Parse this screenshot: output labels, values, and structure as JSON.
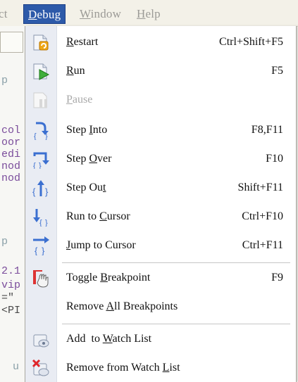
{
  "menubar": {
    "items": [
      {
        "pre": "ct",
        "acc": "",
        "post": ""
      },
      {
        "pre": "",
        "acc": "D",
        "post": "ebug"
      },
      {
        "pre": "",
        "acc": "W",
        "post": "indow"
      },
      {
        "pre": "",
        "acc": "H",
        "post": "elp"
      }
    ]
  },
  "editor": {
    "lines": [
      "p",
      "col",
      "oor",
      "edi",
      "nod",
      "nod",
      "p",
      "2.1",
      "vip",
      "=\"",
      "<PI",
      "u"
    ]
  },
  "menu": {
    "items": [
      {
        "pre": "",
        "acc": "R",
        "post": "estart",
        "shortcut": "Ctrl+Shift+F5",
        "icon": "restart-icon",
        "enabled": true
      },
      {
        "pre": "",
        "acc": "R",
        "post": "un",
        "shortcut": "F5",
        "icon": "run-icon",
        "enabled": true
      },
      {
        "pre": "",
        "acc": "P",
        "post": "ause",
        "shortcut": "",
        "icon": "pause-icon",
        "enabled": false
      },
      {
        "pre": "Step ",
        "acc": "I",
        "post": "nto",
        "shortcut": "F8,F11",
        "icon": "step-into-icon",
        "enabled": true
      },
      {
        "pre": "Step ",
        "acc": "O",
        "post": "ver",
        "shortcut": "F10",
        "icon": "step-over-icon",
        "enabled": true
      },
      {
        "pre": "Step Ou",
        "acc": "t",
        "post": "",
        "shortcut": "Shift+F11",
        "icon": "step-out-icon",
        "enabled": true
      },
      {
        "pre": "Run to ",
        "acc": "C",
        "post": "ursor",
        "shortcut": "Ctrl+F10",
        "icon": "run-to-cursor-icon",
        "enabled": true
      },
      {
        "pre": "",
        "acc": "J",
        "post": "ump to Cursor",
        "shortcut": "Ctrl+F11",
        "icon": "jump-to-cursor-icon",
        "enabled": true
      },
      {
        "pre": "Toggle ",
        "acc": "B",
        "post": "reakpoint",
        "shortcut": "F9",
        "icon": "toggle-breakpoint-icon",
        "enabled": true
      },
      {
        "pre": "Remove ",
        "acc": "A",
        "post": "ll Breakpoints",
        "shortcut": "",
        "icon": "",
        "enabled": true
      },
      {
        "pre": "Add  to ",
        "acc": "W",
        "post": "atch List",
        "shortcut": "",
        "icon": "add-watch-icon",
        "enabled": true
      },
      {
        "pre": "Remove from Watch ",
        "acc": "L",
        "post": "ist",
        "shortcut": "",
        "icon": "remove-watch-icon",
        "enabled": true
      }
    ]
  },
  "colors": {
    "menubar_active_bg": "#2d5aa9",
    "menu_gutter": "#e9ecf3",
    "disabled_text": "#a9a9a9"
  }
}
